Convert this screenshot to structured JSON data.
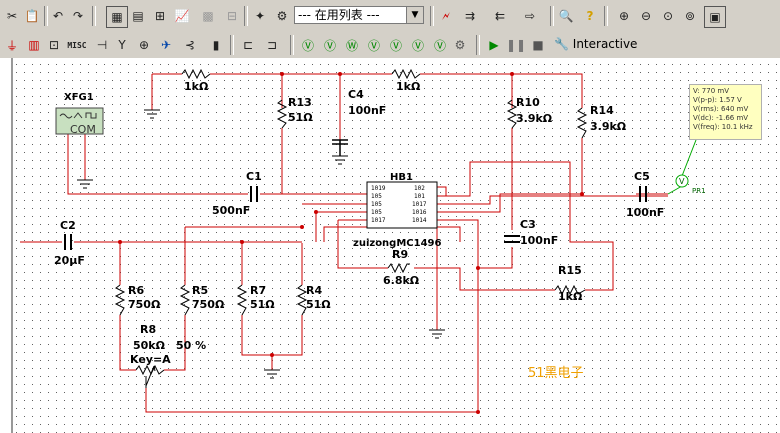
{
  "toolbar": {
    "list_select_value": "--- 在用列表 ---",
    "interactive_label": "Interactive",
    "misc_label": "MISC"
  },
  "components": {
    "r_top_left": {
      "value": "1kΩ"
    },
    "r_top_right": {
      "value": "1kΩ"
    },
    "r13": {
      "ref": "R13",
      "value": "51Ω"
    },
    "c4": {
      "ref": "C4",
      "value": "100nF"
    },
    "r10": {
      "ref": "R10",
      "value": "3.9kΩ"
    },
    "r14": {
      "ref": "R14",
      "value": "3.9kΩ"
    },
    "xfg1": {
      "ref": "XFG1",
      "label": "COM"
    },
    "c1": {
      "ref": "C1",
      "value": "500nF"
    },
    "c2": {
      "ref": "C2",
      "value": "20μF"
    },
    "c3": {
      "ref": "C3",
      "value": "100nF"
    },
    "c5": {
      "ref": "C5",
      "value": "100nF"
    },
    "hb1": {
      "ref": "HB1",
      "part": "zuizongMC1496",
      "pins_left": [
        "1019",
        "105",
        "105",
        "105",
        "1017"
      ],
      "pins_right": [
        "102",
        "101",
        "1017",
        "1016",
        "1014"
      ]
    },
    "r9": {
      "ref": "R9",
      "value": "6.8kΩ"
    },
    "r15": {
      "ref": "R15",
      "value": "1kΩ"
    },
    "r6": {
      "ref": "R6",
      "value": "750Ω"
    },
    "r5": {
      "ref": "R5",
      "value": "750Ω"
    },
    "r7": {
      "ref": "R7",
      "value": "51Ω"
    },
    "r4": {
      "ref": "R4",
      "value": "51Ω"
    },
    "r8": {
      "ref": "R8",
      "value": "50kΩ",
      "percent": "50 %",
      "key": "Key=A"
    },
    "probe": {
      "ref": "PR1",
      "symbol": "V"
    }
  },
  "probe_readout": {
    "v": "V: 770 mV",
    "vpp": "V(p-p): 1.57 V",
    "vrms": "V(rms): 640 mV",
    "vdc": "V(dc): -1.66 mV",
    "vfreq": "V(freq): 10.1 kHz"
  },
  "watermark": "51黑电子",
  "colors": {
    "wire": "#cc0000",
    "component": "#000000",
    "grid_dot": "#606060",
    "highlight_wire": "#00aa00"
  }
}
